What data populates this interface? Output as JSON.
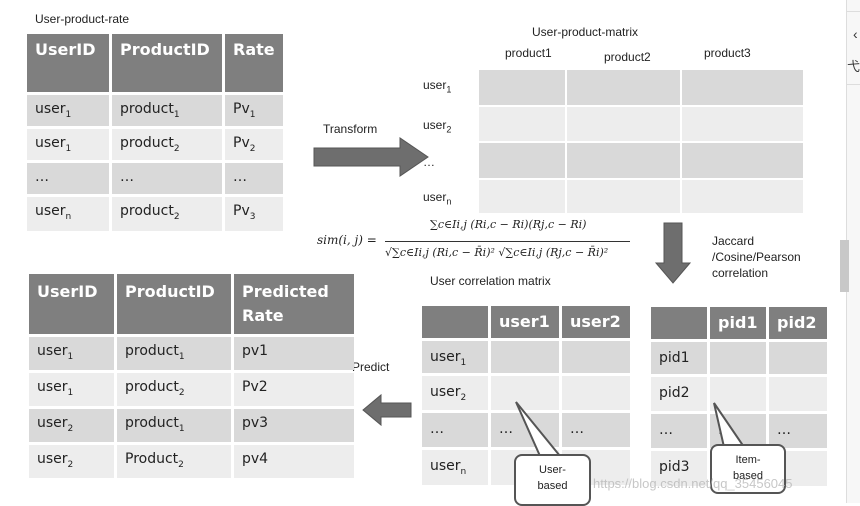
{
  "rate_table": {
    "title": "User-product-rate",
    "headers": [
      "UserID",
      "ProductID",
      "Rate"
    ],
    "rows": [
      [
        {
          "t": "user",
          "s": "1"
        },
        {
          "t": "product",
          "s": "1"
        },
        {
          "t": "Pv",
          "s": "1"
        }
      ],
      [
        {
          "t": "user",
          "s": "1"
        },
        {
          "t": "product",
          "s": "2"
        },
        {
          "t": "Pv",
          "s": "2"
        }
      ],
      [
        {
          "t": "…"
        },
        {
          "t": "…"
        },
        {
          "t": "…"
        }
      ],
      [
        {
          "t": "user",
          "s": "n"
        },
        {
          "t": "product",
          "s": "2"
        },
        {
          "t": "Pv",
          "s": "3"
        }
      ]
    ]
  },
  "transform_label": "Transform",
  "matrix": {
    "title": "User-product-matrix",
    "columns": [
      "product1",
      "product2",
      "product3"
    ],
    "rows": [
      {
        "t": "user",
        "s": "1"
      },
      {
        "t": "user",
        "s": "2"
      },
      {
        "t": "…"
      },
      {
        "t": "user",
        "s": "n"
      }
    ]
  },
  "formula": {
    "lhs": "sim(i, j) =",
    "numerator": "∑c∈Ii,j (Ri,c − Ri)(Rj,c − Ri)",
    "denominator": "√∑c∈Ii,j (Ri,c − R̄i)²  √∑c∈Ii,j (Rj,c − R̄i)²"
  },
  "correlation_label": "User correlation matrix",
  "similarity_label": "Jaccard\n/Cosine/Pearson\ncorrelation",
  "user_corr": {
    "headers": [
      "",
      "user1",
      "user2"
    ],
    "rows": [
      [
        {
          "t": "user",
          "s": "1"
        },
        {
          "t": ""
        },
        {
          "t": ""
        }
      ],
      [
        {
          "t": "user",
          "s": "2"
        },
        {
          "t": ""
        },
        {
          "t": ""
        }
      ],
      [
        {
          "t": "…"
        },
        {
          "t": "…"
        },
        {
          "t": "…"
        }
      ],
      [
        {
          "t": "user",
          "s": "n"
        },
        {
          "t": ""
        },
        {
          "t": ""
        }
      ]
    ]
  },
  "item_corr": {
    "headers": [
      "",
      "pid1",
      "pid2"
    ],
    "rows": [
      [
        {
          "t": "pid1"
        },
        {
          "t": ""
        },
        {
          "t": ""
        }
      ],
      [
        {
          "t": "pid2"
        },
        {
          "t": ""
        },
        {
          "t": ""
        }
      ],
      [
        {
          "t": "…"
        },
        {
          "t": "…"
        },
        {
          "t": "…"
        }
      ],
      [
        {
          "t": "pid3"
        },
        {
          "t": ""
        },
        {
          "t": ""
        }
      ]
    ]
  },
  "predict_label": "Predict",
  "predicted_table": {
    "headers": [
      "UserID",
      "ProductID",
      "Predicted Rate"
    ],
    "rows": [
      [
        {
          "t": "user",
          "s": "1"
        },
        {
          "t": "product",
          "s": "1"
        },
        {
          "t": "pv1"
        }
      ],
      [
        {
          "t": "user",
          "s": "1"
        },
        {
          "t": "product",
          "s": "2"
        },
        {
          "t": "Pv2"
        }
      ],
      [
        {
          "t": "user",
          "s": "2"
        },
        {
          "t": "product",
          "s": "1"
        },
        {
          "t": "pv3"
        }
      ],
      [
        {
          "t": "user",
          "s": "2"
        },
        {
          "t": "Product",
          "s": "2"
        },
        {
          "t": "pv4"
        }
      ]
    ]
  },
  "callouts": {
    "user": "User-\nbased",
    "item": "Item-\nbased"
  },
  "watermark": "https://blog.csdn.net/qq_35456045",
  "side_panel": {
    "back_icon": "chevron-left-icon",
    "glyph": "弋"
  },
  "colors": {
    "header": "#7f7f7f",
    "row_dark": "#d9d9d9",
    "row_light": "#ededed",
    "arrow": "#6e6e6e"
  }
}
